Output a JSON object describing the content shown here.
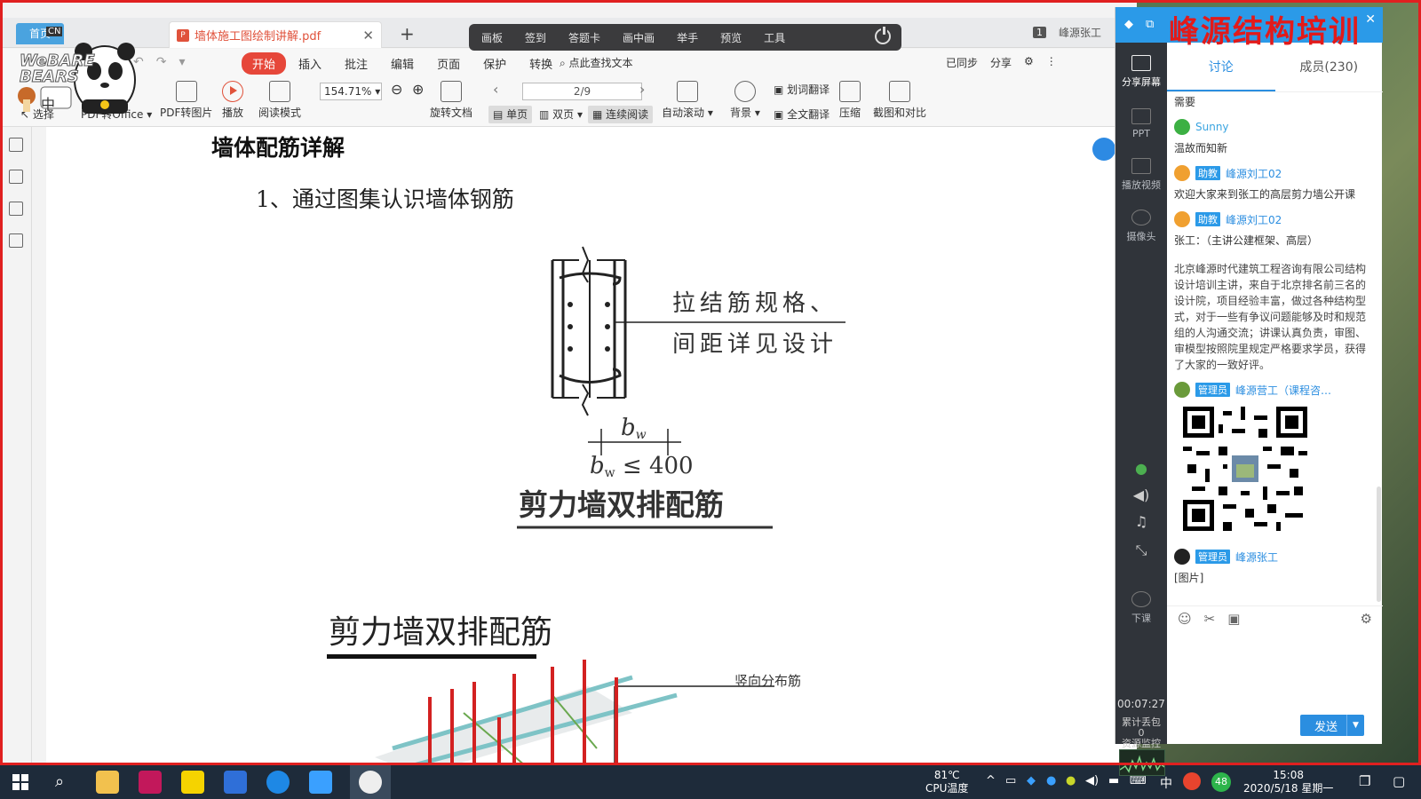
{
  "colors": {
    "accent_red": "#e6473a",
    "chat_blue": "#2b9ae8",
    "brand_red": "#e21a1a",
    "rail_dark": "#30343a",
    "taskbar": "#1e2b3a"
  },
  "tabs": {
    "home": "首页",
    "doc": "墙体施工图绘制讲解.pdf",
    "doc_icon": "pdf-icon",
    "new": "+",
    "page_counter": "1",
    "user": "峰源张工"
  },
  "float_toolbar": {
    "items": [
      "画板",
      "签到",
      "答题卡",
      "画中画",
      "举手",
      "预览",
      "工具"
    ]
  },
  "menu": {
    "items": [
      "开始",
      "插入",
      "批注",
      "编辑",
      "页面",
      "保护",
      "转换"
    ],
    "active": "开始",
    "search": "点此查找文本",
    "right": [
      "已同步",
      "分享"
    ]
  },
  "ribbon": {
    "select": "选择",
    "pdf_to_office": "PDF转Office",
    "pdf_to_image": "PDF转图片",
    "play": "播放",
    "read_mode": "阅读模式",
    "zoom": "154.71%",
    "rotate": "旋转文档",
    "page": "2/9",
    "single": "单页",
    "double": "双页",
    "continuous": "连续阅读",
    "auto_scroll": "自动滚动",
    "background": "背景",
    "word_translate": "划词翻译",
    "full_translate": "全文翻译",
    "compress": "压缩",
    "screenshot_compare": "截图和对比"
  },
  "document": {
    "heading": "墙体配筋详解",
    "sub": "1、通过图集认识墙体钢筋",
    "fig1_note_line1": "拉结筋规格、",
    "fig1_note_line2": "间距详见设计",
    "fig1_bw": "b",
    "fig1_bw_sub": "w",
    "fig1_formula_b": "b",
    "fig1_formula_sub": "w",
    "fig1_formula_rest": " ≤ 400",
    "fig1_caption": "剪力墙双排配筋",
    "fig2_title": "剪力墙双排配筋",
    "fig2_label": "竖向分布筋"
  },
  "overlay": {
    "bare_bears_line1": "WeBARE",
    "bare_bears_line2": "BEARS",
    "badge_cn": "CN",
    "ime": "中"
  },
  "chat": {
    "brand": "峰源结构培训",
    "tabs": [
      "讨论",
      "成员(230)"
    ],
    "rail": [
      "分享屏幕",
      "PPT",
      "播放视频",
      "摄像头",
      "下课"
    ],
    "timer": "00:07:27",
    "stat_line1": "累计丢包",
    "stat_line2": "0",
    "stat_line3": "资源监控",
    "messages": [
      {
        "name": "",
        "role": "",
        "text": "需要"
      },
      {
        "name": "Sunny",
        "role": "",
        "text": "温故而知新"
      },
      {
        "name": "峰源刘工02",
        "role": "助教",
        "text": "欢迎大家来到张工的高层剪力墙公开课"
      },
      {
        "name": "峰源刘工02",
        "role": "助教",
        "text": "张工：（主讲公建框架、高层）"
      },
      {
        "name": "",
        "role": "",
        "text": "北京峰源时代建筑工程咨询有限公司结构设计培训主讲，来自于北京排名前三名的设计院，项目经验丰富，做过各种结构型式，对于一些有争议问题能够及时和规范组的人沟通交流；讲课认真负责，审图、审模型按照院里规定严格要求学员，获得了大家的一致好评。"
      },
      {
        "name": "峰源营工（课程咨…",
        "role": "管理员",
        "text": ""
      },
      {
        "name": "峰源张工",
        "role": "管理员",
        "text": "[图片]"
      }
    ],
    "send": "发送",
    "send_arrow": "▼"
  },
  "taskbar": {
    "temp": "81℃",
    "temp_label": "CPU温度",
    "ime": "中",
    "badge": "48",
    "time": "15:08",
    "date": "2020/5/18 星期一"
  }
}
